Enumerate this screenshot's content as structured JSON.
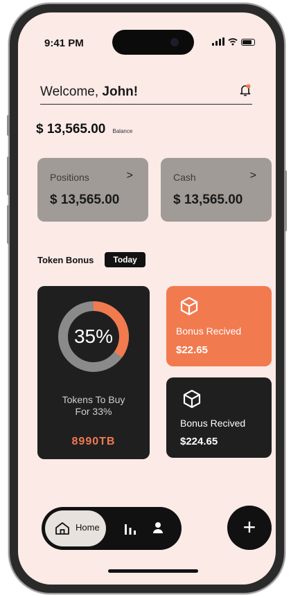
{
  "status": {
    "time": "9:41 PM"
  },
  "header": {
    "welcome_prefix": "Welcome, ",
    "user_name": "John!"
  },
  "balance": {
    "amount": "$ 13,565.00",
    "label": "Balance"
  },
  "cards": [
    {
      "label": "Positions",
      "amount": "$ 13,565.00"
    },
    {
      "label": "Cash",
      "amount": "$ 13,565.00"
    }
  ],
  "chevron": ">",
  "token_bonus": {
    "title": "Token Bonus",
    "filter": "Today",
    "percent_text": "35%",
    "percent_value": 35,
    "description": "Tokens To Buy\nFor 33%",
    "tokens": "8990TB"
  },
  "bonus_cards": [
    {
      "title": "Bonus Recived",
      "value": "$22.65",
      "icon": "cube-icon"
    },
    {
      "title": "Bonus Recived",
      "value": "$224.65",
      "icon": "cube-icon"
    }
  ],
  "nav": {
    "home_label": "Home",
    "fab_label": "+"
  },
  "colors": {
    "accent": "#f27a4f",
    "dark": "#1f1f1f",
    "background": "#fbeae6",
    "card_gray": "#a09b97"
  }
}
